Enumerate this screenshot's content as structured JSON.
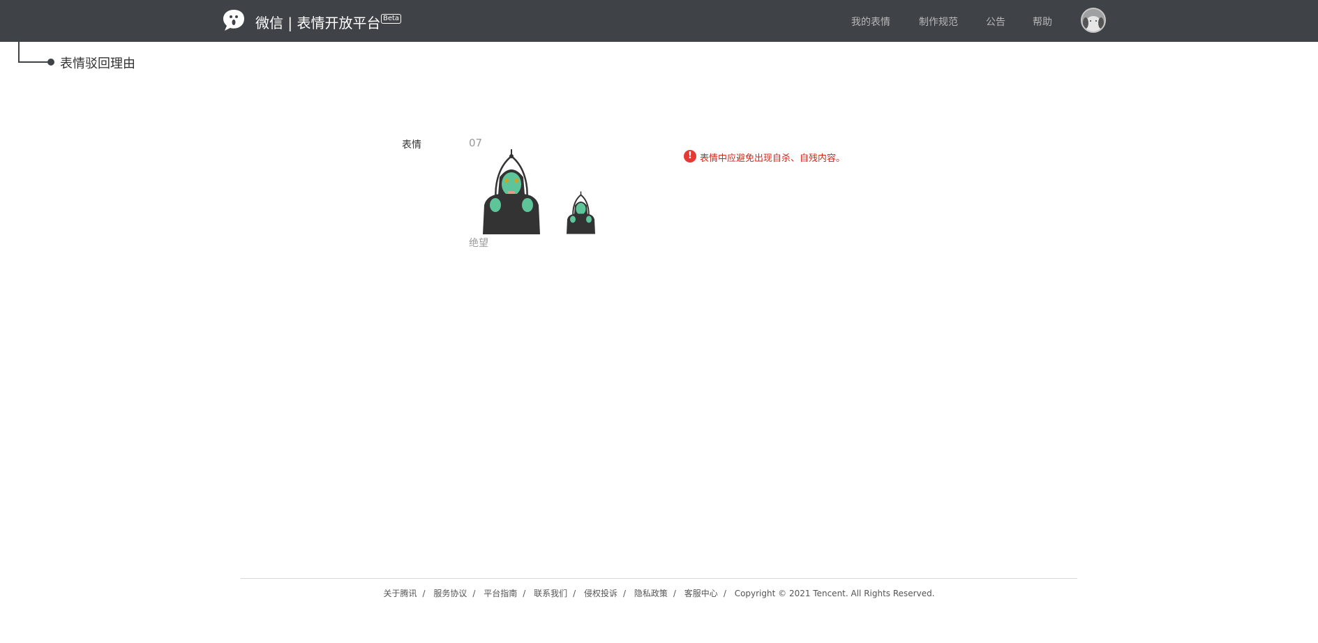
{
  "header": {
    "brand": "微信 | 表情开放平台",
    "beta": "Beta",
    "nav": [
      "我的表情",
      "制作规范",
      "公告",
      "帮助"
    ]
  },
  "breadcrumb": {
    "title": "表情驳回理由"
  },
  "main": {
    "label": "表情",
    "index": "07",
    "caption": "绝望",
    "error": "表情中应避免出现自杀、自残内容。"
  },
  "footer": {
    "links": [
      "关于腾讯",
      "服务协议",
      "平台指南",
      "联系我们",
      "侵权投诉",
      "隐私政策",
      "客服中心"
    ],
    "copyright": "Copyright © 2021 Tencent. All Rights Reserved."
  },
  "colors": {
    "header_bg": "#3f4246",
    "error": "#d0271d"
  }
}
